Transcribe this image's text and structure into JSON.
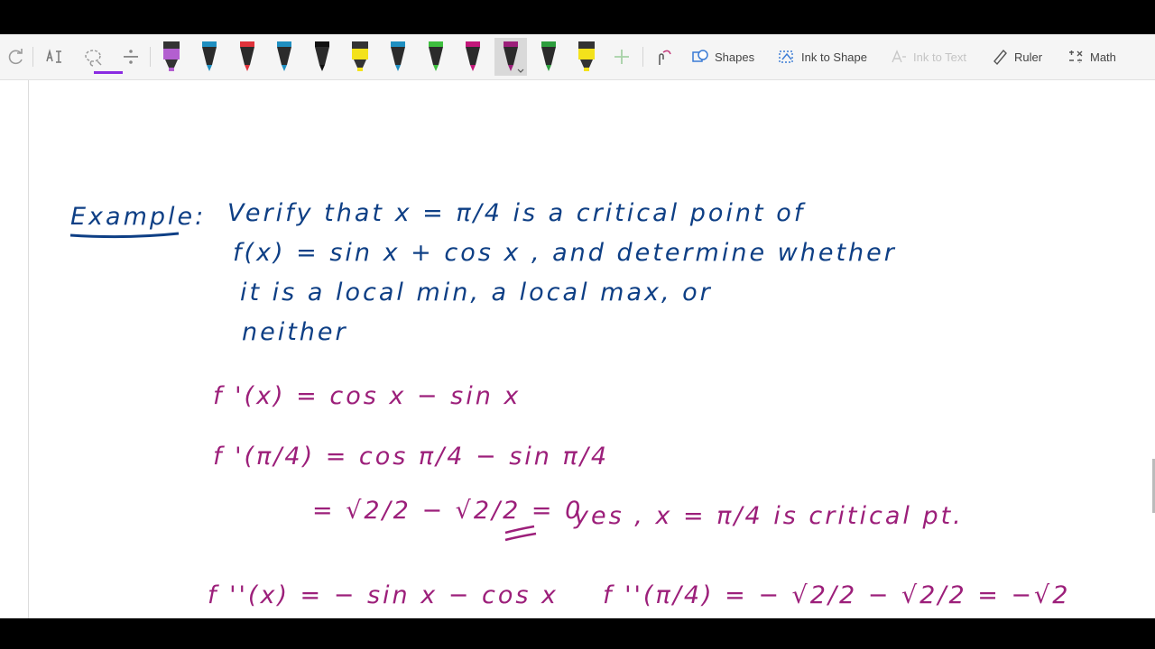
{
  "toolbar": {
    "shapes_label": "Shapes",
    "ink_to_shape_label": "Ink to Shape",
    "ink_to_text_label": "Ink to Text",
    "ruler_label": "Ruler",
    "math_label": "Math",
    "icons": [
      "redo-icon",
      "text-select-icon",
      "lasso-select-icon",
      "eraser-icon",
      "add-pen-icon",
      "touch-writing-icon",
      "shapes-icon",
      "ink-to-shape-icon",
      "ink-to-text-icon",
      "ruler-icon",
      "math-icon"
    ],
    "pens": [
      {
        "kind": "highlighter",
        "color": "#b35fd0"
      },
      {
        "kind": "pen",
        "color": "#1f8fc1"
      },
      {
        "kind": "pen",
        "color": "#e0333b"
      },
      {
        "kind": "pen",
        "color": "#1f8fc1"
      },
      {
        "kind": "pen",
        "color": "#111111"
      },
      {
        "kind": "highlighter",
        "color": "#f3e21b"
      },
      {
        "kind": "pen",
        "color": "#1f8fc1"
      },
      {
        "kind": "pen",
        "color": "#3fbf3f"
      },
      {
        "kind": "pen",
        "color": "#c2187a"
      },
      {
        "kind": "pen",
        "color": "#9c1f7a",
        "selected": true
      },
      {
        "kind": "pen",
        "color": "#2e9e3e"
      },
      {
        "kind": "highlighter",
        "color": "#f3e21b"
      }
    ]
  },
  "ink": {
    "example_label": "Example:",
    "problem_lines": [
      "Verify that  x = π/4  is a critical point of",
      "f(x) = sin x + cos x , and determine whether",
      "it is a local min, a local max, or",
      "neither"
    ],
    "work_lines": [
      "f '(x) = cos x  − sin x",
      "f '(π/4) = cos π/4 − sin π/4",
      "= √2/2 − √2/2 = 0",
      "yes , x = π/4 is critical pt.",
      "f ''(x) = − sin x − cos x",
      "f ''(π/4) = − √2/2 − √2/2 = −√2"
    ]
  },
  "colors": {
    "blue_ink": "#0e3f85",
    "purple_ink": "#9c1f7a"
  }
}
